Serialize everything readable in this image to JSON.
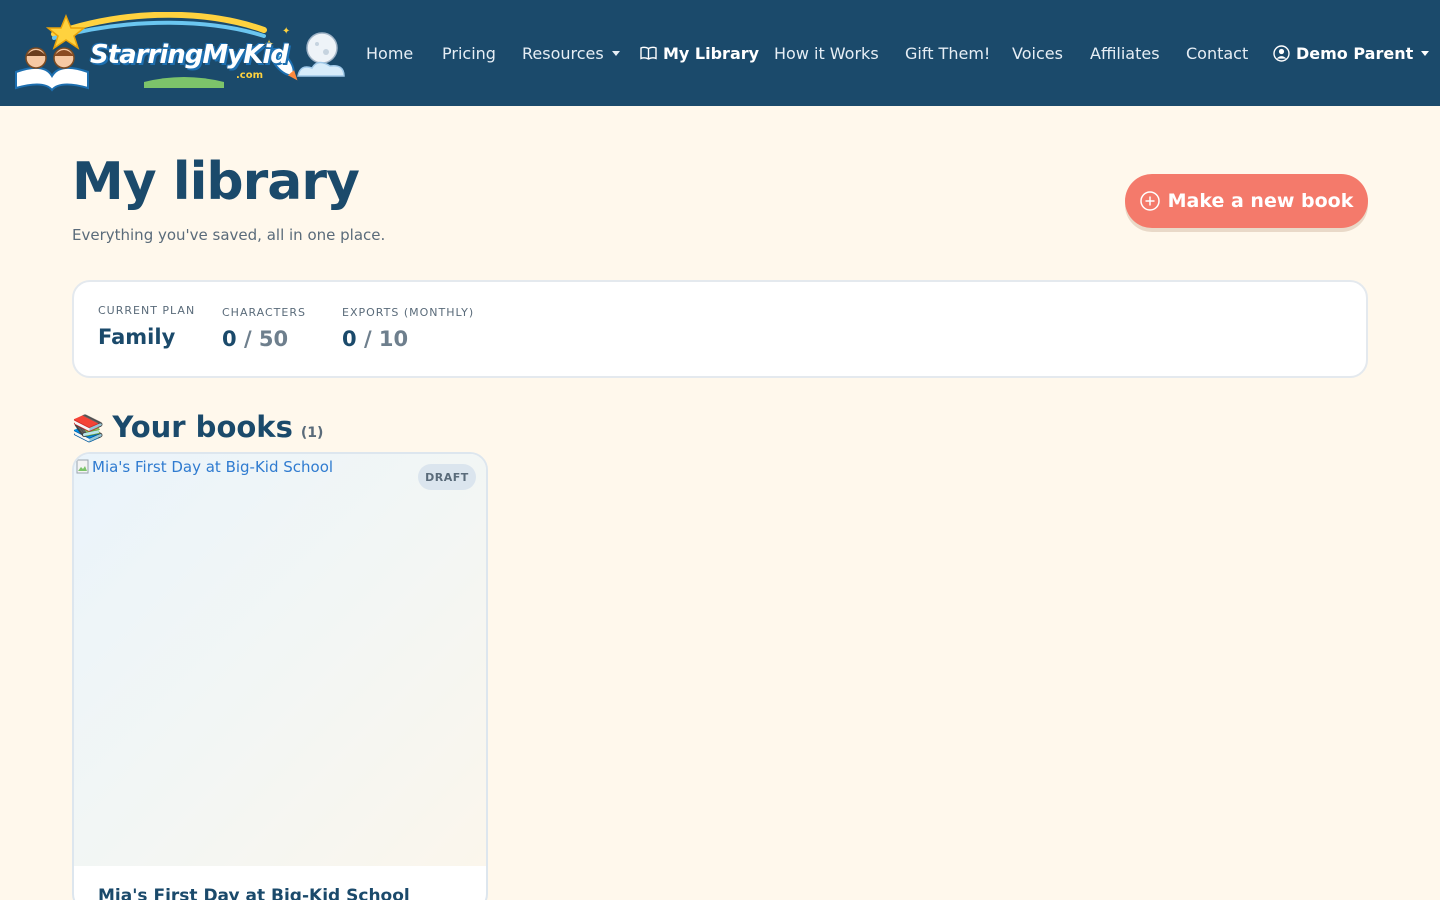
{
  "brand": {
    "logo_text": "StarringMyKid",
    "logo_suffix": ".com"
  },
  "nav": {
    "home": "Home",
    "pricing": "Pricing",
    "resources": "Resources",
    "my_library": "My Library",
    "how_it_works": "How it Works",
    "gift_them": "Gift Them!",
    "voices": "Voices",
    "affiliates": "Affiliates",
    "contact": "Contact",
    "user": "Demo Parent"
  },
  "header": {
    "title": "My library",
    "subtitle": "Everything you've saved, all in one place.",
    "new_book_button": "Make a new book"
  },
  "plan": {
    "current_plan_label": "Current plan",
    "current_plan_value": "Family",
    "characters_label": "Characters",
    "characters_used": "0",
    "characters_limit": "/ 50",
    "exports_label": "Exports (monthly)",
    "exports_used": "0",
    "exports_limit": "/ 10"
  },
  "books_section": {
    "emoji": "📚",
    "title": "Your books",
    "count": "(1)",
    "books": [
      {
        "title": "Mia's First Day at Big-Kid School",
        "cover_alt": "Mia's First Day at Big-Kid School",
        "status": "DRAFT"
      }
    ]
  },
  "colors": {
    "navbar": "#1b4a6b",
    "background": "#fff8ec",
    "accent_button": "#f47a6b",
    "text_primary": "#1b4a6b"
  }
}
